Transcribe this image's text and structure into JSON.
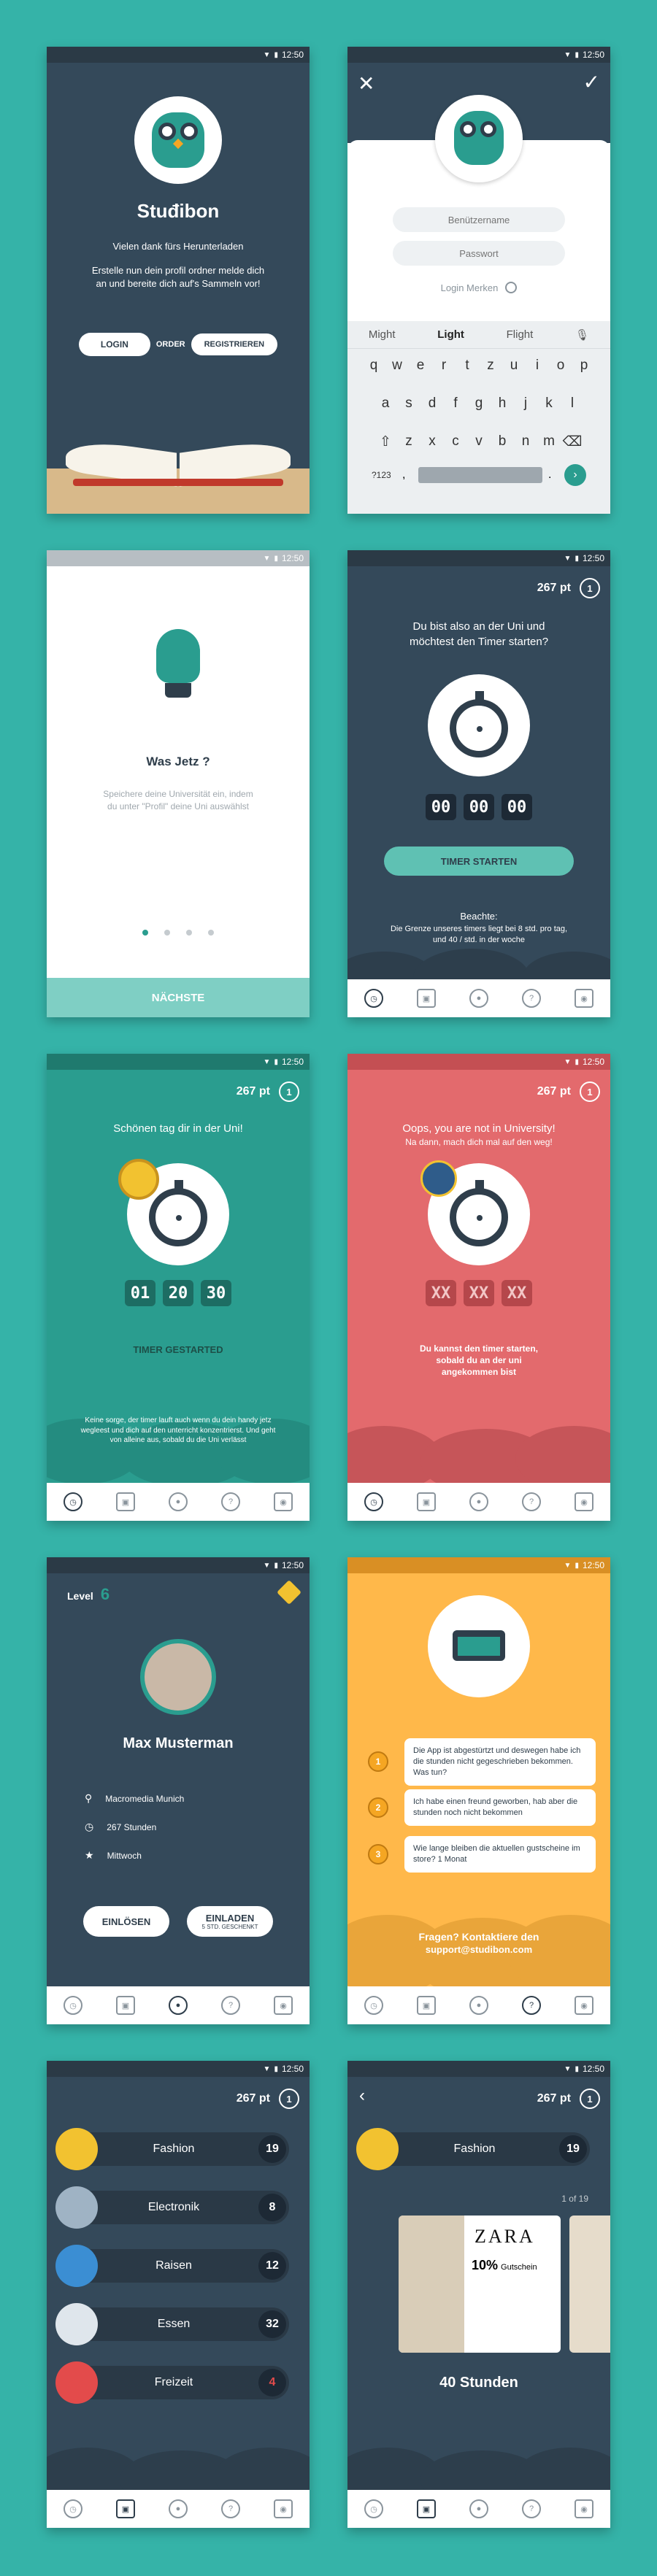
{
  "status": {
    "time": "12:50"
  },
  "colors": {
    "background": "#35b3a8",
    "dark": "#34495a",
    "teal": "#2a9d8f",
    "red": "#e36a6d",
    "yellow": "#ffb84a"
  },
  "tabs": [
    {
      "icon": "stopwatch-icon"
    },
    {
      "icon": "gift-icon"
    },
    {
      "icon": "profile-icon"
    },
    {
      "icon": "help-icon"
    },
    {
      "icon": "owl-icon"
    }
  ],
  "points": "267 pt",
  "ring_label": "1",
  "welcome": {
    "logo": "Stuđibon",
    "tagline": "Vielen dank fürs Herunterladen",
    "description": "Erstelle nun dein profil ordner melde dich an und bereite dich auf's Sammeln vor!",
    "login": "LOGIN",
    "order": "ORDER",
    "register": "REGISTRIEREN"
  },
  "login": {
    "username_placeholder": "Benützername",
    "password_placeholder": "Passwort",
    "remember": "Login Merken",
    "suggestions": [
      "Might",
      "Light",
      "Flight"
    ],
    "rows": [
      [
        "q",
        "w",
        "e",
        "r",
        "t",
        "z",
        "u",
        "i",
        "o",
        "p"
      ],
      [
        "a",
        "s",
        "d",
        "f",
        "g",
        "h",
        "j",
        "k",
        "l"
      ],
      [
        "z",
        "x",
        "c",
        "v",
        "b",
        "n",
        "m"
      ]
    ],
    "numkey": "?123",
    "comma": ",",
    "period": "."
  },
  "onboarding": {
    "title": "Was Jetz ?",
    "text": "Speichere deine Universität ein, indem du unter \"Profil\" deine Uni auswählst",
    "next": "NÄCHSTE"
  },
  "timer_start": {
    "title": "Du bist also an der Uni und möchtest den Timer starten?",
    "time": [
      "00",
      "00",
      "00"
    ],
    "button": "TIMER STARTEN",
    "note_title": "Beachte:",
    "note": "Die Grenze unseres timers liegt bei 8 std. pro tag, und 40 / std. in der woche"
  },
  "timer_running": {
    "title": "Schönen tag dir in der Uni!",
    "time": [
      "01",
      "20",
      "30"
    ],
    "status": "TIMER GESTARTED",
    "note": "Keine sorge, der timer lauft auch wenn du dein handy jetz wegleest und dich auf den unterricht konzentrierst. Und geht von alleine aus, sobald du die Uni verlässt"
  },
  "not_in_uni": {
    "title": "Oops, you are not in University!",
    "subtitle": "Na dann, mach dich mal auf den weg!",
    "time": [
      "XX",
      "XX",
      "XX"
    ],
    "note": "Du kannst den timer starten, sobald du an der uni angekommen bist"
  },
  "profile": {
    "level_label": "Level",
    "level": "6",
    "name": "Max Musterman",
    "location": "Macromedia Munich",
    "hours": "267 Stunden",
    "day": "Mittwoch",
    "redeem": "EINLÖSEN",
    "invite": "EINLADEN",
    "invite_sub": "5 STD. GESCHENKT"
  },
  "faq": {
    "items": [
      {
        "num": "1",
        "text": "Die App ist abgestürtzt und deswegen habe ich die stunden nicht gegeschrieben bekommen. Was tun?"
      },
      {
        "num": "2",
        "text": "Ich habe einen freund geworben, hab aber die stunden noch nicht bekommen"
      },
      {
        "num": "3",
        "text": "Wie lange bleiben die aktuellen gustscheine im store? 1 Monat"
      }
    ],
    "contact": "Fragen? Kontaktiere den",
    "email": "support@studibon.com"
  },
  "categories": [
    {
      "name": "Fashion",
      "count": "19",
      "color": "#f2c230"
    },
    {
      "name": "Electronik",
      "count": "8",
      "color": "#9fb3c4"
    },
    {
      "name": "Raisen",
      "count": "12",
      "color": "#3b8ed3"
    },
    {
      "name": "Essen",
      "count": "32",
      "color": "#dfe6ec"
    },
    {
      "name": "Freizeit",
      "count": "4",
      "color": "#e34b4b"
    }
  ],
  "store": {
    "category": "Fashion",
    "count": "19",
    "pager": "1 of 19",
    "brand": "ZARA",
    "discount": "10%",
    "discount_label": "Gutschein",
    "cost": "40 Stunden"
  }
}
